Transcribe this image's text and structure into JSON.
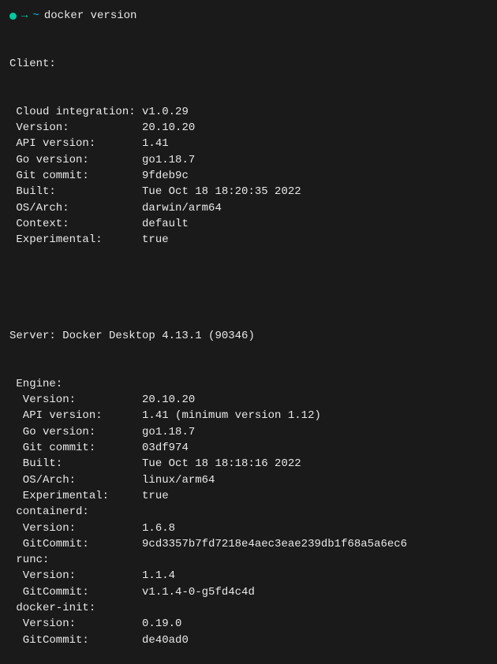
{
  "prompt": {
    "arrow": "→",
    "tilde": "~",
    "command": "docker version"
  },
  "client": {
    "header": "Client:",
    "rows": [
      {
        "label": " Cloud integration: ",
        "value": "v1.0.29"
      },
      {
        "label": " Version:           ",
        "value": "20.10.20"
      },
      {
        "label": " API version:       ",
        "value": "1.41"
      },
      {
        "label": " Go version:        ",
        "value": "go1.18.7"
      },
      {
        "label": " Git commit:        ",
        "value": "9fdeb9c"
      },
      {
        "label": " Built:             ",
        "value": "Tue Oct 18 18:20:35 2022"
      },
      {
        "label": " OS/Arch:           ",
        "value": "darwin/arm64"
      },
      {
        "label": " Context:           ",
        "value": "default"
      },
      {
        "label": " Experimental:      ",
        "value": "true"
      }
    ]
  },
  "server": {
    "header": "Server: Docker Desktop 4.13.1 (90346)",
    "sections": [
      {
        "name": " Engine:",
        "rows": [
          {
            "label": "  Version:          ",
            "value": "20.10.20"
          },
          {
            "label": "  API version:      ",
            "value": "1.41 (minimum version 1.12)"
          },
          {
            "label": "  Go version:       ",
            "value": "go1.18.7"
          },
          {
            "label": "  Git commit:       ",
            "value": "03df974"
          },
          {
            "label": "  Built:            ",
            "value": "Tue Oct 18 18:18:16 2022"
          },
          {
            "label": "  OS/Arch:          ",
            "value": "linux/arm64"
          },
          {
            "label": "  Experimental:     ",
            "value": "true"
          }
        ]
      },
      {
        "name": " containerd:",
        "rows": [
          {
            "label": "  Version:          ",
            "value": "1.6.8"
          },
          {
            "label": "  GitCommit:        ",
            "value": "9cd3357b7fd7218e4aec3eae239db1f68a5a6ec6"
          }
        ]
      },
      {
        "name": " runc:",
        "rows": [
          {
            "label": "  Version:          ",
            "value": "1.1.4"
          },
          {
            "label": "  GitCommit:        ",
            "value": "v1.1.4-0-g5fd4c4d"
          }
        ]
      },
      {
        "name": " docker-init:",
        "rows": [
          {
            "label": "  Version:          ",
            "value": "0.19.0"
          },
          {
            "label": "  GitCommit:        ",
            "value": "de40ad0"
          }
        ]
      }
    ]
  }
}
